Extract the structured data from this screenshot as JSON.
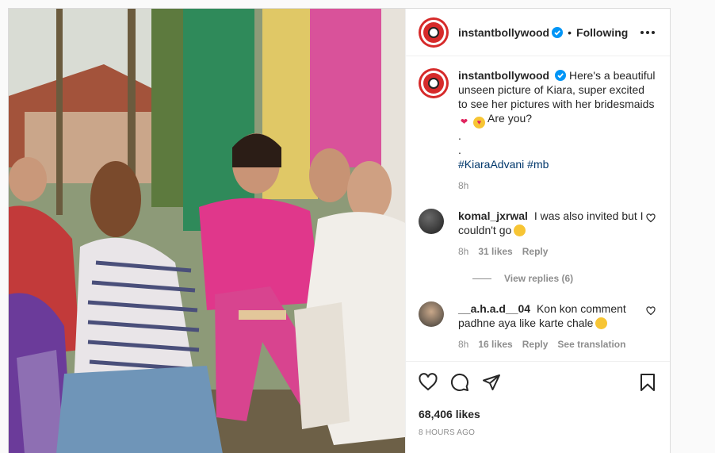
{
  "post": {
    "account": "instantbollywood",
    "separator": "•",
    "follow_status": "Following",
    "more_icon": "more-options-icon",
    "photo_description_icon": "photo"
  },
  "caption": {
    "username": "instantbollywood",
    "text": "Here's a beautiful unseen picture of Kiara, super excited to see her pictures with her bridesmaids",
    "question": "Are you?",
    "dot1": ".",
    "dot2": ".",
    "hashtags": "#KiaraAdvani #mb",
    "time": "8h"
  },
  "comments": [
    {
      "username": "komal_jxrwal",
      "text": "I was also invited but I couldn't go",
      "time": "8h",
      "likes": "31 likes",
      "reply": "Reply",
      "view_replies": "View replies (6)"
    },
    {
      "username": "__a.h.a.d__04",
      "text": "Kon kon comment padhne aya like karte chale",
      "time": "8h",
      "likes": "16 likes",
      "reply": "Reply",
      "translate": "See translation"
    }
  ],
  "actions": {
    "like_icon": "heart-icon",
    "comment_icon": "comment-icon",
    "share_icon": "share-icon",
    "save_icon": "bookmark-icon",
    "likes_count": "68,406 likes",
    "posted": "8 HOURS AGO"
  },
  "colors": {
    "verified": "#0095f6",
    "brand_red": "#d62a2a",
    "link": "#00376b",
    "muted": "#8e8e8e"
  }
}
